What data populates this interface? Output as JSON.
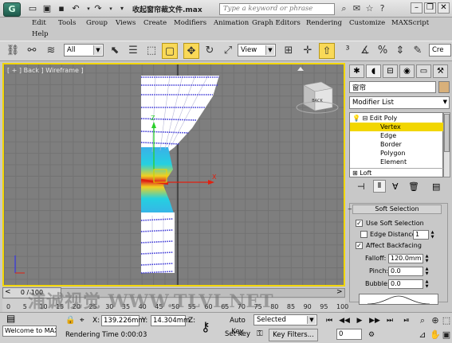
{
  "titlebar": {
    "doc_title": "收起窗帘裁文件.max",
    "search_placeholder": "Type a keyword or phrase"
  },
  "menu": [
    "Edit",
    "Tools",
    "Group",
    "Views",
    "Create",
    "Modifiers",
    "Animation",
    "Graph Editors",
    "Rendering",
    "Customize",
    "MAXScript",
    "Help"
  ],
  "toolbar": {
    "selection_filter": "All",
    "ref_coord": "View",
    "named_sel": "Cre"
  },
  "viewport": {
    "label": "[ + ] Back ] Wireframe ]",
    "viewcube_label": "BACK",
    "axis_label": "z x"
  },
  "panel": {
    "object_name": "窗帘",
    "object_color": "#d8b07a",
    "modifier_list": "Modifier List",
    "stack": [
      {
        "label": "Edit Poly",
        "level": 0
      },
      {
        "label": "Vertex",
        "level": 1
      },
      {
        "label": "Edge",
        "level": 1
      },
      {
        "label": "Border",
        "level": 1
      },
      {
        "label": "Polygon",
        "level": 1
      },
      {
        "label": "Element",
        "level": 1
      },
      {
        "label": "Loft",
        "level": 0
      }
    ],
    "soft_selection": {
      "title": "Soft Selection",
      "use_soft": "Use Soft Selection",
      "edge_distance": "Edge Distance:",
      "edge_distance_value": "1",
      "affect_backfacing": "Affect Backfacing",
      "falloff_label": "Falloff:",
      "falloff_value": "120.0mm",
      "pinch_label": "Pinch:",
      "pinch_value": "0.0",
      "bubble_label": "Bubble:",
      "bubble_value": "0.0"
    }
  },
  "timeline": {
    "frame": "0 / 100",
    "ticks": [
      "0",
      "5",
      "10",
      "15",
      "20",
      "25",
      "30",
      "35",
      "40",
      "45",
      "50",
      "55",
      "60",
      "65",
      "70",
      "75",
      "80",
      "85",
      "90",
      "95",
      "100"
    ],
    "watermark": "浦诚视觉 WWW.TLVI.NET"
  },
  "status": {
    "welcome": "Welcome to MAX",
    "x_label": "X:",
    "x_value": "139.226mm",
    "y_label": "Y:",
    "y_value": "14.304mm",
    "z_label": "Z:",
    "rendering_time": "Rendering Time  0:00:03",
    "auto_key": "Auto Key",
    "set_key": "Set Key",
    "key_mode": "Selected",
    "key_filters": "Key Filters...",
    "frame_value": "0"
  },
  "colors": {
    "accent_yellow": "#f2d600",
    "viewport_bg": "#7e7e7e",
    "mesh_white": "#ffffff",
    "vertex_blue": "#3a35d6"
  }
}
